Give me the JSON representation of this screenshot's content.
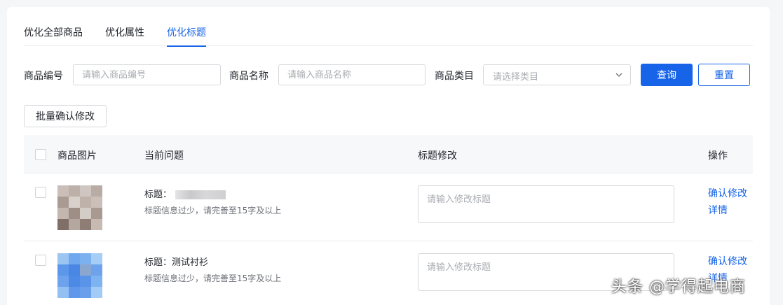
{
  "tabs": [
    {
      "label": "优化全部商品",
      "active": false
    },
    {
      "label": "优化属性",
      "active": false
    },
    {
      "label": "优化标题",
      "active": true
    }
  ],
  "filters": {
    "product_code_label": "商品编号",
    "product_code_placeholder": "请输入商品编号",
    "product_name_label": "商品名称",
    "product_name_placeholder": "请输入商品名称",
    "category_label": "商品类目",
    "category_placeholder": "请选择类目",
    "query_button": "查询",
    "reset_button": "重置"
  },
  "batch_button": "批量确认修改",
  "table": {
    "headers": [
      "商品图片",
      "当前问题",
      "标题修改",
      "操作"
    ],
    "rows": [
      {
        "title": "标题：",
        "issue": "标题信息过少，请完善至15字及以上",
        "edit_placeholder": "请输入修改标题",
        "actions": [
          "确认修改",
          "详情"
        ]
      },
      {
        "title": "标题：测试衬衫",
        "issue": "标题信息过少，请完善至15字及以上",
        "edit_placeholder": "请输入修改标题",
        "actions": [
          "确认修改",
          "详情"
        ]
      }
    ]
  },
  "watermark": "头条 @学得起电商",
  "colors": {
    "accent": "#1764e8",
    "header_bg": "#f7f8fa",
    "page_bg": "#f5f6f8"
  }
}
